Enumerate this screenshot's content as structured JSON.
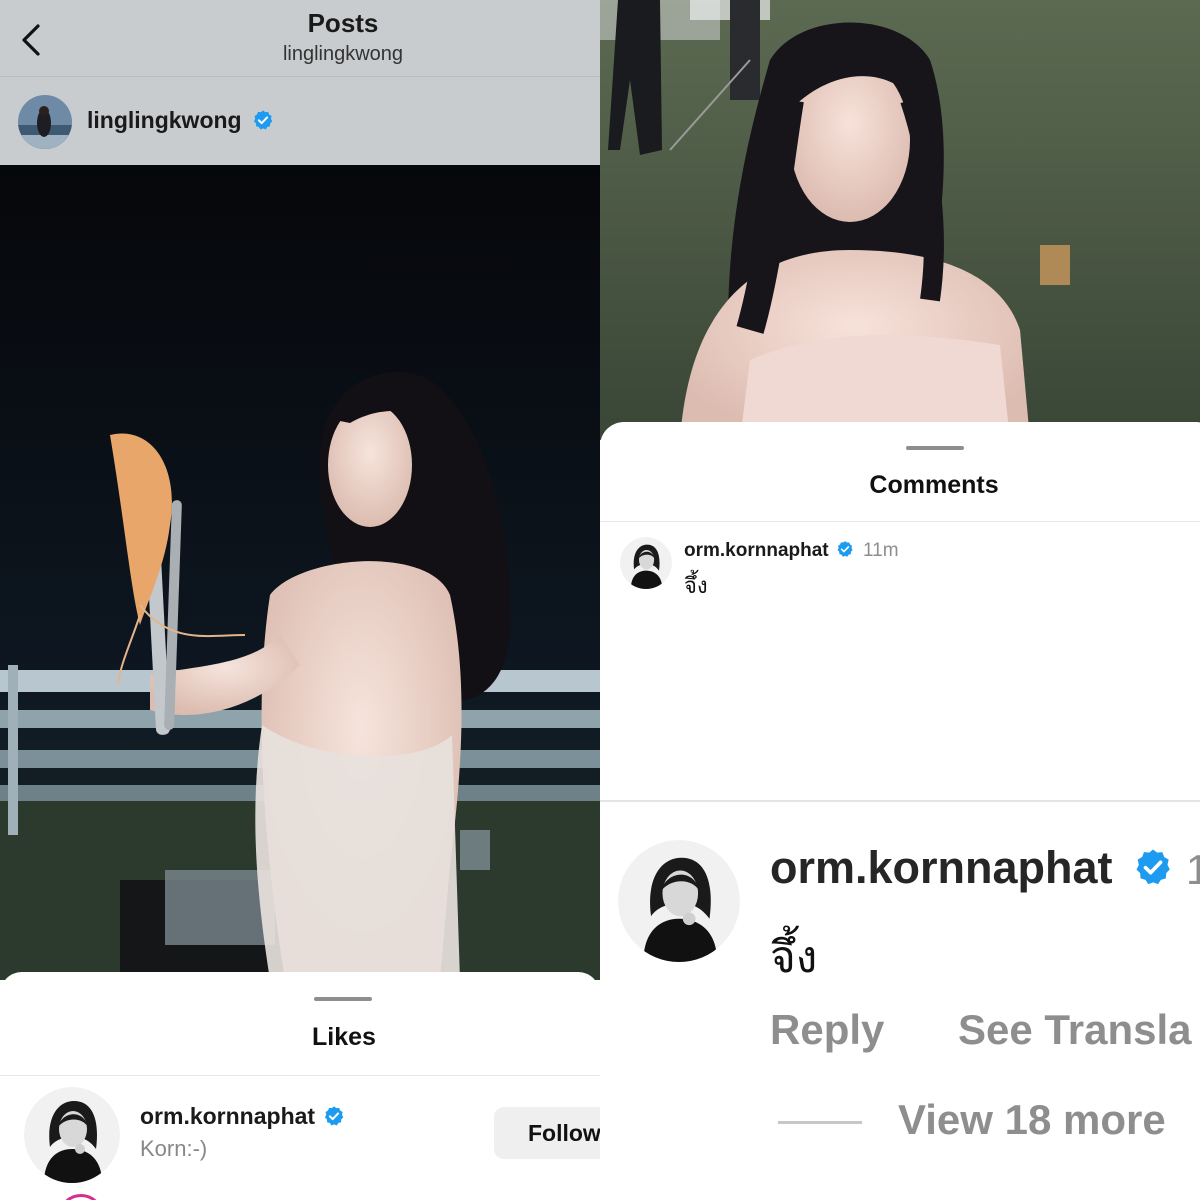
{
  "left_panel": {
    "header": {
      "title": "Posts",
      "subtitle": "linglingkwong"
    },
    "post": {
      "author": "linglingkwong",
      "verified": true
    },
    "likes_sheet": {
      "title": "Likes",
      "items": [
        {
          "username": "orm.kornnaphat",
          "verified": true,
          "full_name": "Korn:-)",
          "button_label": "Follow"
        }
      ]
    }
  },
  "right_panel": {
    "comments_sheet": {
      "title": "Comments",
      "comments": [
        {
          "username": "orm.kornnaphat",
          "verified": true,
          "time": "11m",
          "text": "จึ้ง"
        }
      ]
    },
    "zoomed_comment": {
      "username": "orm.kornnaphat",
      "time_partial": "1",
      "text": "จึ้ง",
      "reply_label": "Reply",
      "translate_label": "See Transla",
      "view_more_label": "View 18 more"
    }
  },
  "colors": {
    "verified_blue": "#1d9bf0",
    "header_gray": "#c9ccce",
    "follow_button_bg": "#efefef",
    "muted_text": "#8e8e8e"
  },
  "icons": [
    "back-chevron-icon",
    "verified-badge-icon"
  ]
}
